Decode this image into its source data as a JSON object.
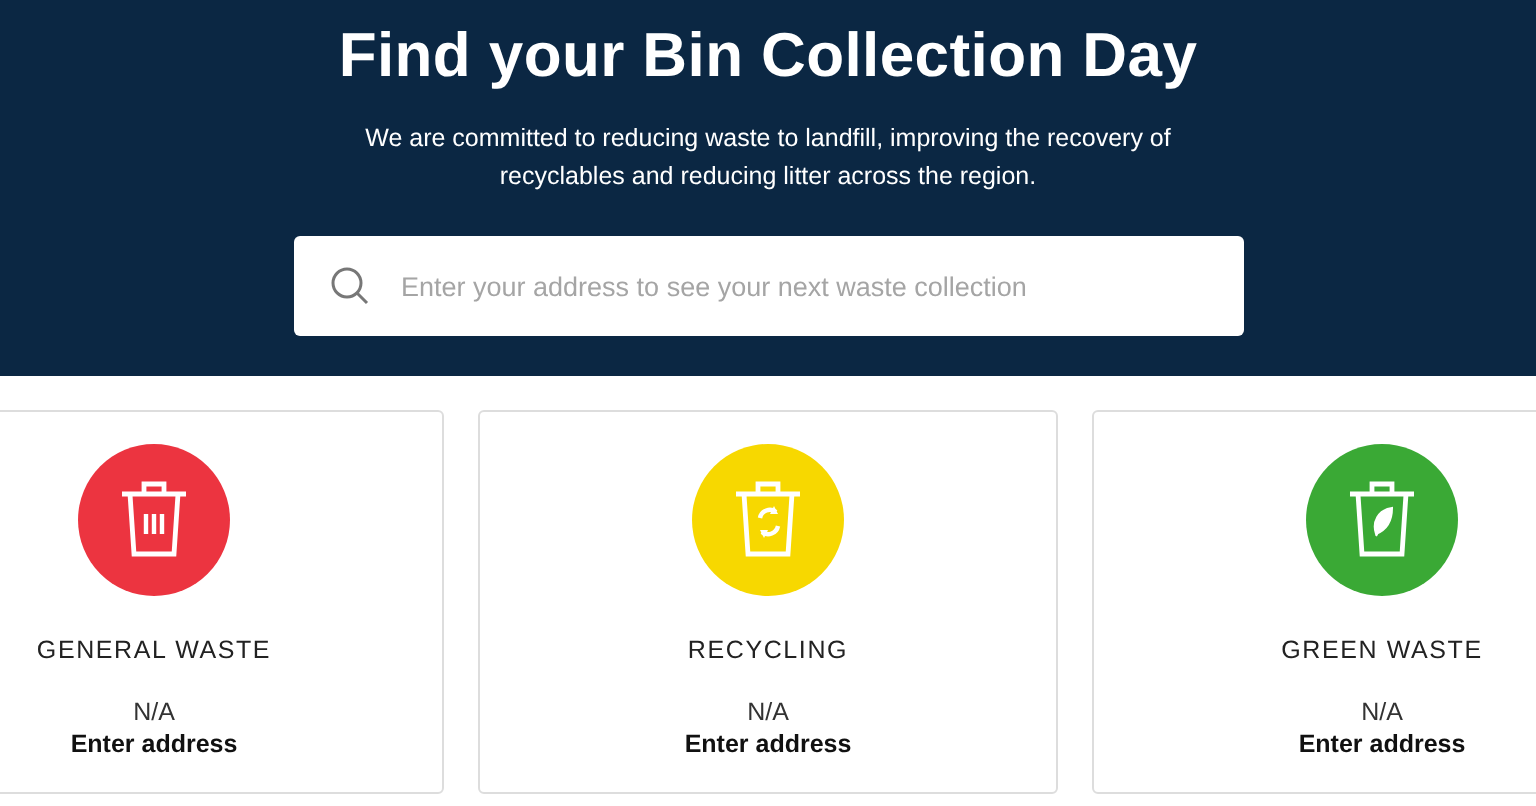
{
  "hero": {
    "title": "Find your Bin Collection Day",
    "subtitle": "We are committed to reducing waste to landfill, improving the recovery of recyclables and reducing litter across the region."
  },
  "search": {
    "placeholder": "Enter your address to see your next waste collection"
  },
  "bins": [
    {
      "kind": "general",
      "color": "#ec3440",
      "name": "GENERAL WASTE",
      "date": "N/A",
      "action": "Enter address"
    },
    {
      "kind": "recycling",
      "color": "#f7d800",
      "name": "RECYCLING",
      "date": "N/A",
      "action": "Enter address"
    },
    {
      "kind": "green",
      "color": "#3aa935",
      "name": "GREEN WASTE",
      "date": "N/A",
      "action": "Enter address"
    }
  ]
}
